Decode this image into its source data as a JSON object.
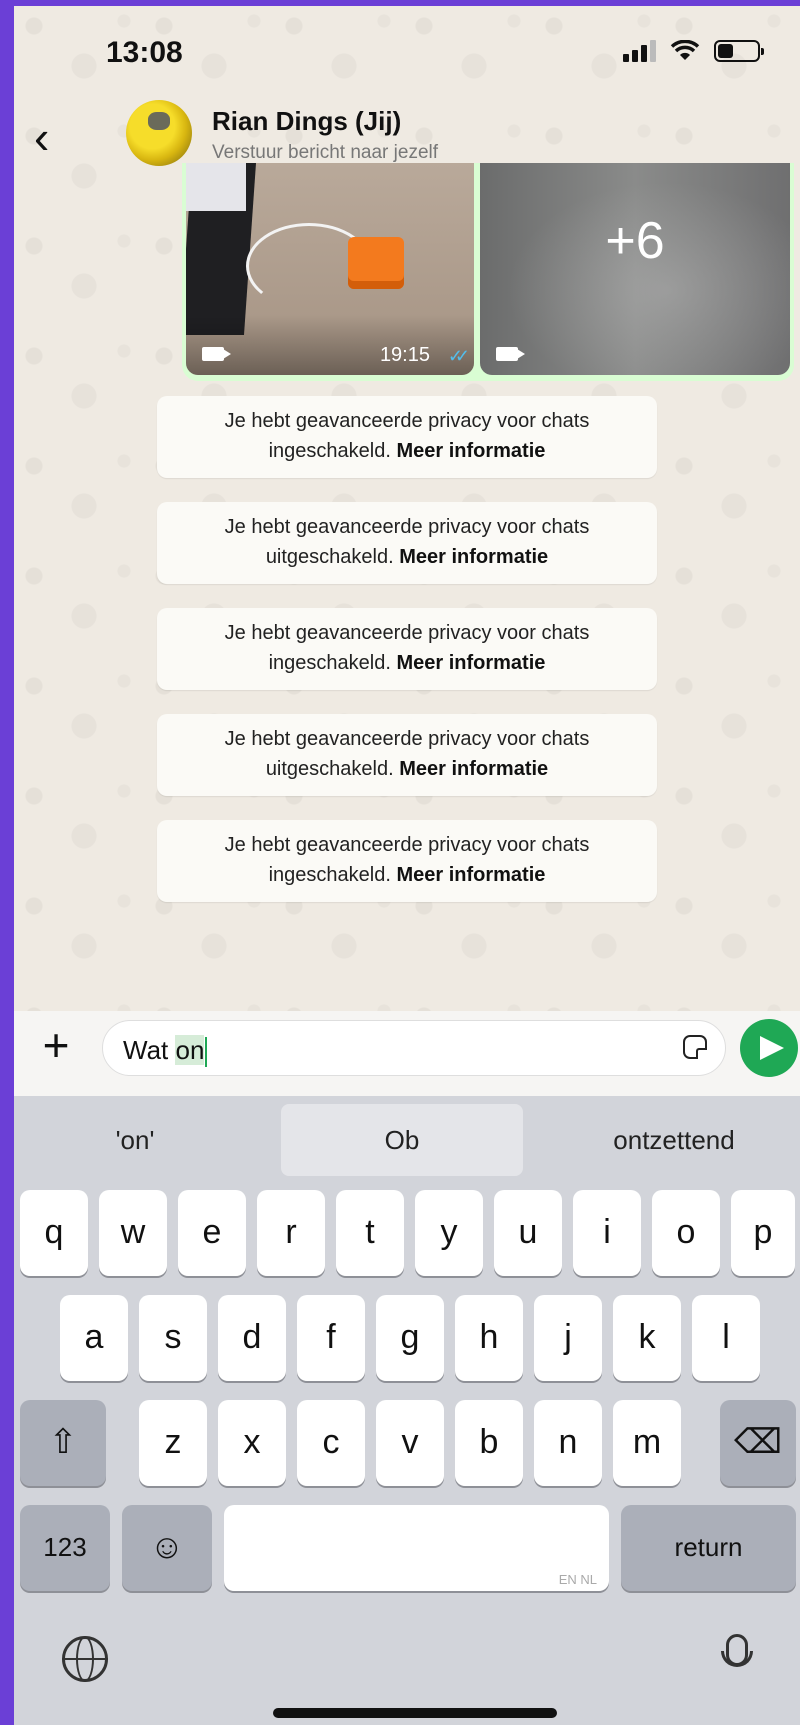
{
  "status_bar": {
    "time": "13:08",
    "battery_level": 0.4
  },
  "header": {
    "back_glyph": "‹",
    "contact_name": "Rian Dings (Jij)",
    "subtitle": "Verstuur bericht naar jezelf"
  },
  "media": {
    "video1_time": "19:15",
    "read_ticks": "✓✓",
    "more_count": "+6"
  },
  "notices": [
    {
      "text": "Je hebt geavanceerde privacy voor chats",
      "line2": "ingeschakeld.",
      "link": "Meer informatie"
    },
    {
      "text": "Je hebt geavanceerde privacy voor chats",
      "line2": "uitgeschakeld.",
      "link": "Meer informatie"
    },
    {
      "text": "Je hebt geavanceerde privacy voor chats",
      "line2": "ingeschakeld.",
      "link": "Meer informatie"
    },
    {
      "text": "Je hebt geavanceerde privacy voor chats",
      "line2": "uitgeschakeld.",
      "link": "Meer informatie"
    },
    {
      "text": "Je hebt geavanceerde privacy voor chats",
      "line2": "ingeschakeld.",
      "link": "Meer informatie"
    }
  ],
  "composer": {
    "plus_glyph": "+",
    "typed_text": "Wat ",
    "typed_highlight": "on"
  },
  "suggestions": [
    "'on'",
    "Ob",
    "ontzettend"
  ],
  "keyboard": {
    "row1": [
      "q",
      "w",
      "e",
      "r",
      "t",
      "y",
      "u",
      "i",
      "o",
      "p"
    ],
    "row2": [
      "a",
      "s",
      "d",
      "f",
      "g",
      "h",
      "j",
      "k",
      "l"
    ],
    "row3": [
      "z",
      "x",
      "c",
      "v",
      "b",
      "n",
      "m"
    ],
    "shift_glyph": "⇧",
    "delete_glyph": "⌫",
    "numbers_label": "123",
    "emoji_glyph": "☺",
    "space_hint": "EN NL",
    "return_label": "return"
  },
  "colors": {
    "accent": "#1fa855",
    "chat_bg": "#efeae2",
    "outer_bg": "#6b3fd6"
  }
}
